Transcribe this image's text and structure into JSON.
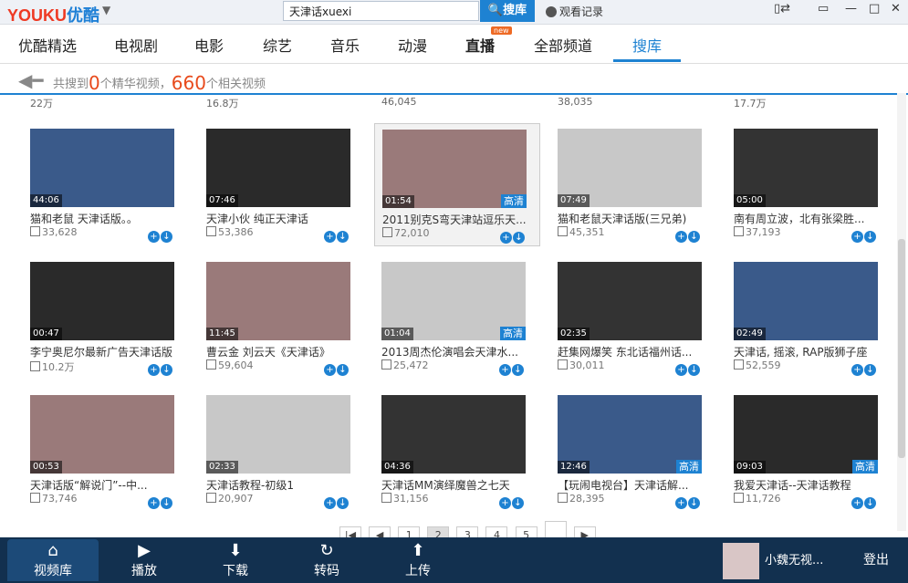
{
  "app": {
    "logo_a": "YOUKU",
    "logo_b": "优酷"
  },
  "search": {
    "value": "天津话xuexi",
    "button": "搜库",
    "history": "观看记录"
  },
  "nav": {
    "tabs": [
      "优酷精选",
      "电视剧",
      "电影",
      "综艺",
      "音乐",
      "动漫",
      "直播",
      "全部频道",
      "搜库"
    ],
    "badge": "new"
  },
  "summary": {
    "prefix": "共搜到",
    "count1": "0",
    "mid": "个精华视频，",
    "count2": "660",
    "suffix": "个相关视频"
  },
  "top_row_counts": [
    "22万",
    "16.8万",
    "46,045",
    "38,035",
    "17.7万"
  ],
  "rows": [
    [
      {
        "title": "猫和老鼠 天津话版。。",
        "plays": "33,628",
        "dur": "44:06",
        "hd": ""
      },
      {
        "title": "天津小伙   纯正天津话",
        "plays": "53,386",
        "dur": "07:46",
        "hd": ""
      },
      {
        "title": "2011别克S弯天津站逗乐天...",
        "plays": "72,010",
        "dur": "01:54",
        "hd": "高清"
      },
      {
        "title": "猫和老鼠天津话版(三兄弟)",
        "plays": "45,351",
        "dur": "07:49",
        "hd": ""
      },
      {
        "title": "南有周立波，北有张梁胜...",
        "plays": "37,193",
        "dur": "05:00",
        "hd": ""
      }
    ],
    [
      {
        "title": "李宁奥尼尔最新广告天津话版",
        "plays": "10.2万",
        "dur": "00:47",
        "hd": ""
      },
      {
        "title": "曹云金 刘云天《天津话》",
        "plays": "59,604",
        "dur": "11:45",
        "hd": ""
      },
      {
        "title": "2013周杰伦演唱会天津水...",
        "plays": "25,472",
        "dur": "01:04",
        "hd": "高清"
      },
      {
        "title": "赶集网爆笑 东北话福州话...",
        "plays": "30,011",
        "dur": "02:35",
        "hd": ""
      },
      {
        "title": "天津话, 摇滚, RAP版狮子座",
        "plays": "52,559",
        "dur": "02:49",
        "hd": ""
      }
    ],
    [
      {
        "title": "天津话版“解说门”--中...",
        "plays": "73,746",
        "dur": "00:53",
        "hd": ""
      },
      {
        "title": "天津话教程-初级1",
        "plays": "20,907",
        "dur": "02:33",
        "hd": ""
      },
      {
        "title": "天津话MM演绎魔兽之七天",
        "plays": "31,156",
        "dur": "04:36",
        "hd": ""
      },
      {
        "title": "【玩闹电视台】天津话解...",
        "plays": "28,395",
        "dur": "12:46",
        "hd": "高清"
      },
      {
        "title": "我爱天津话--天津话教程",
        "plays": "11,726",
        "dur": "09:03",
        "hd": "高清"
      }
    ]
  ],
  "pager": {
    "pages": [
      "1",
      "2",
      "3",
      "4",
      "5"
    ]
  },
  "bottom": {
    "tabs": [
      "视频库",
      "播放",
      "下载",
      "转码",
      "上传"
    ],
    "user": "小魏无视...",
    "logout": "登出"
  },
  "colors": {
    "accent": "#1e82d2",
    "bottom": "#12304f"
  }
}
